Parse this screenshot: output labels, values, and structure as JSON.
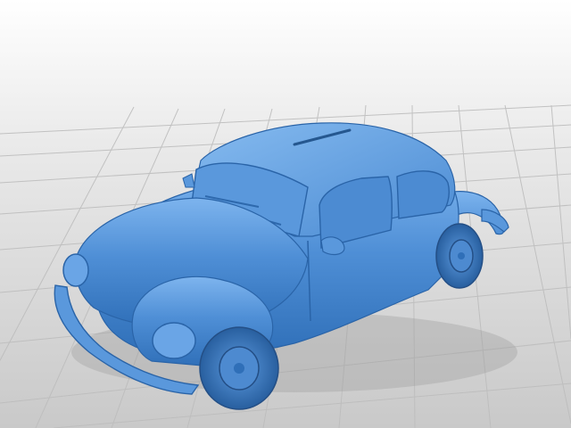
{
  "scene": {
    "subject": "car-model-3d-render",
    "model_color": "#4f8fd6",
    "model_shadow_color": "#2f6fb8",
    "model_highlight_color": "#7db4ee",
    "background_top_color": "#ffffff",
    "background_bottom_color": "#cfcfcf",
    "grid_color": "#bdbdbd",
    "grid_visible": true
  }
}
